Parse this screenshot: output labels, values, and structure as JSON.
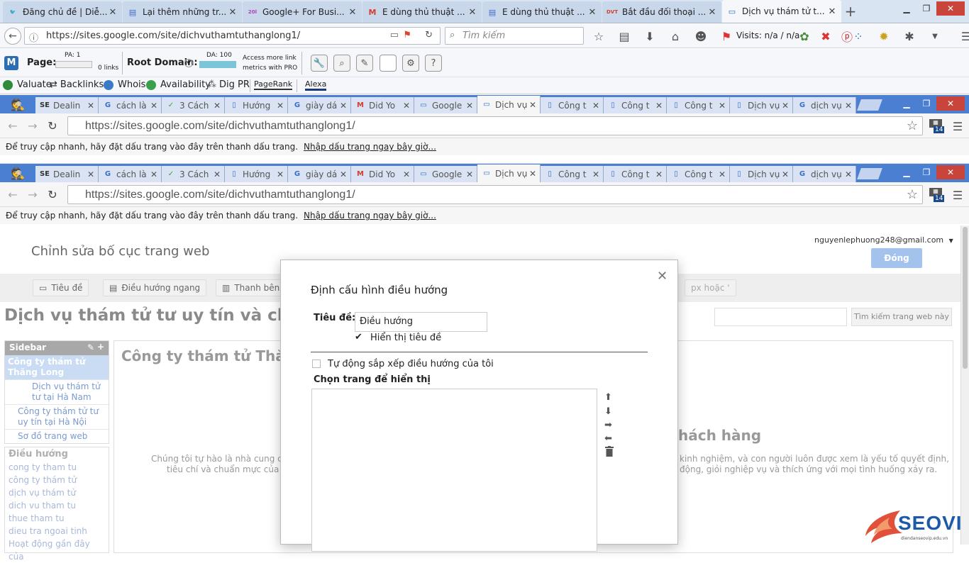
{
  "firefox": {
    "tabs": [
      {
        "label": "Đăng chủ đề | Diễ...",
        "icon": "bird-icon"
      },
      {
        "label": "Lại thêm những tr...",
        "icon": "document-icon"
      },
      {
        "label": "Google+ For Busi...",
        "icon": "g-plus-icon"
      },
      {
        "label": "E dùng thủ thuật ...",
        "icon": "gmail-icon"
      },
      {
        "label": "E dùng thủ thuật ...",
        "icon": "document-icon"
      },
      {
        "label": "Bắt đầu đối thoại ...",
        "icon": "dvt-icon"
      },
      {
        "label": "Dịch vụ thám tử t...",
        "icon": "sites-icon",
        "active": true
      }
    ],
    "url": "https://sites.google.com/site/dichvuthamtuthanglong1/",
    "search_placeholder": "Tìm kiếm",
    "visits": "Visits: n/a / n/a"
  },
  "moz": {
    "page_label": "Page:",
    "pa": "PA: 1",
    "links": "0 links",
    "root_label": "Root Domain:",
    "da": "DA: 100",
    "access_line1": "Access more link",
    "access_line2": "metrics with PRO"
  },
  "seo": {
    "valuate": "Valuate",
    "backlinks": "Backlinks",
    "whois": "Whois",
    "availability": "Availability",
    "digpr": "Dig PR",
    "pagerank": "PageRank",
    "alexa": "Alexa"
  },
  "chrome": {
    "tabs": [
      {
        "label": "Dealin",
        "icon": "sej-icon"
      },
      {
        "label": "cách là",
        "icon": "google-icon"
      },
      {
        "label": "3 Cách",
        "icon": "chart-icon"
      },
      {
        "label": "Hướng",
        "icon": "document-icon"
      },
      {
        "label": "giày dá",
        "icon": "google-icon"
      },
      {
        "label": "Did Yo",
        "icon": "gmail-icon"
      },
      {
        "label": "Google",
        "icon": "sites-icon"
      },
      {
        "label": "Dịch vụ",
        "icon": "sites-icon",
        "active": true
      },
      {
        "label": "Công t",
        "icon": "document-icon"
      },
      {
        "label": "Công t",
        "icon": "document-icon"
      },
      {
        "label": "Công t",
        "icon": "document-icon"
      },
      {
        "label": "Dịch vụ",
        "icon": "document-icon"
      },
      {
        "label": "dịch vụ",
        "icon": "google-icon"
      }
    ],
    "url": "https://sites.google.com/site/dichvuthamtuthanglong1/",
    "bookmark_hint": "Để truy cập nhanh, hãy đặt dấu trang vào đây trên thanh dấu trang.",
    "bookmark_link": "Nhập dấu trang ngay bây giờ...",
    "badge": "14"
  },
  "sites": {
    "page_title": "Chỉnh sửa bố cục trang web",
    "account": "nguyenlephuong248@gmail.com",
    "close_button": "Đóng",
    "toolbar": [
      "Tiêu đề",
      "Điều hướng ngang",
      "Thanh bên"
    ],
    "width_hint": "px hoặc '",
    "site_title": "Dịch vụ thám tử tư uy tín và chuyê",
    "search_button": "Tìm kiếm trang web này",
    "sidebar_title": "Sidebar",
    "sidebar_items": [
      "Công ty thám tử Thăng Long",
      "Dịch vụ thám tử tư tại Hà Nam",
      "Công ty thám tử tư uy tín tại Hà Nội",
      "Sơ đồ trang web"
    ],
    "nav_title": "Điều hướng",
    "nav_links": [
      "cong ty tham tu",
      "công ty thám tử",
      "dịch vụ thám tử",
      "dich vu tham tu",
      "thue tham tu",
      "dieu tra ngoai tinh",
      "Hoạt động gần đây của"
    ],
    "main_heading": "Công ty thám tử Thăn",
    "right_heading": "hách hàng",
    "body_left_1": "Chúng tôi tự hào là nhà cung ca",
    "body_left_2": "tiêu chí và chuẩn mực của",
    "body_right_1": "kinh nghiệm, và con người luôn được xem là yếu tố quyết định,",
    "body_right_2": "động, giỏi nghiệp vụ và thích ứng với mọi tình huống xảy ra."
  },
  "dialog": {
    "title": "Định cấu hình điều hướng",
    "title_label": "Tiêu đề:",
    "title_value": "Điều hướng",
    "show_title": "Hiển thị tiêu đề",
    "auto_sort": "Tự động sắp xếp điều hướng của tôi",
    "choose_pages": "Chọn trang để hiển thị"
  },
  "watermark": {
    "brand": "SEOVIP",
    "site": "diendanseovip.edu.vn"
  }
}
